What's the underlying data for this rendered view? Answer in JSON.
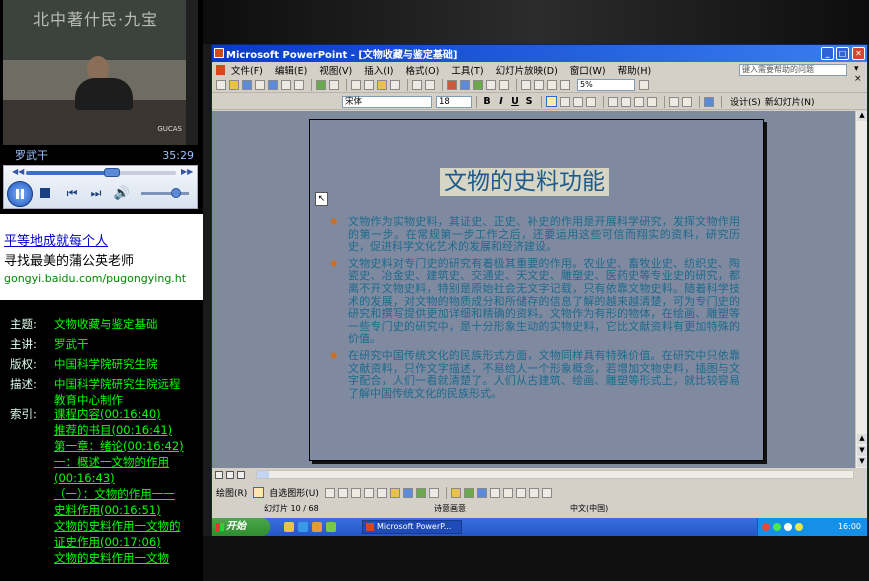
{
  "player": {
    "lecturer_caption": "罗武干",
    "elapsed_time": "35:29",
    "board_text": "北中著什民·九宝",
    "camera_logo": "GUCAS",
    "progress_fraction": 0.57,
    "volume_fraction": 0.72,
    "icons": [
      "rewind-icon",
      "fast-forward-icon",
      "pause-icon",
      "stop-icon",
      "previous-icon",
      "next-icon",
      "volume-icon"
    ]
  },
  "ad": {
    "headline": "平等地成就每个人",
    "subline": "寻找最美的蒲公英老师",
    "url": "gongyi.baidu.com/pugongying.ht"
  },
  "course_info": {
    "rows": [
      {
        "label": "主题:",
        "value": "文物收藏与鉴定基础"
      },
      {
        "label": "主讲:",
        "value": "罗武干"
      },
      {
        "label": "版权:",
        "value": "中国科学院研究生院"
      },
      {
        "label": "描述:",
        "value": "中国科学院研究生院远程教育中心制作"
      }
    ],
    "index_label": "索引:",
    "index_items": [
      "课程内容(00:16:40)",
      "推荐的书目(00:16:41)",
      "第一章：绪论(00:16:42)",
      "一：概述一文物的作用(00:16:43)",
      "（一）：文物的作用一一史料作用(00:16:51)",
      "文物的史料作用一文物的证史作用(00:17:06)",
      "文物的史料作用一文物"
    ]
  },
  "powerpoint": {
    "window_title": "Microsoft PowerPoint - [文物收藏与鉴定基础]",
    "menu": [
      "文件(F)",
      "编辑(E)",
      "视图(V)",
      "插入(I)",
      "格式(O)",
      "工具(T)",
      "幻灯片放映(D)",
      "窗口(W)",
      "帮助(H)"
    ],
    "help_placeholder": "键入需要帮助的问题",
    "zoom": "5%",
    "font_name": "宋体",
    "font_size": "18",
    "format_buttons": [
      "B",
      "I",
      "U",
      "S"
    ],
    "design_button": "设计(S)",
    "new_slide_button": "新幻灯片(N)",
    "slide": {
      "title": "文物的史料功能",
      "bullets": [
        "文物作为实物史料，其证史、正史、补史的作用是开展科学研究，发挥文物作用的第一步。在常规第一步工作之后，还要运用这些可信而翔实的资料，研究历史，促进科学文化艺术的发展和经济建设。",
        "文物史料对专门史的研究有着极其重要的作用。农业史、畜牧业史、纺织史、陶瓷史、冶金史、建筑史、交通史、天文史、雕塑史、医药史等专业史的研究，都离不开文物史料，特别是原始社会无文字记载，只有依靠文物史料。随着科学技术的发展，对文物的物质成分和所储存的信息了解的越来越清楚，可为专门史的研究和撰写提供更加详细和精确的资料。文物作为有形的物体，在绘画、雕塑等一些专门史的研究中，是十分形象生动的实物史料，它比文献资料有更加特殊的价值。",
        "在研究中国传统文化的民族形式方面，文物同样具有特殊价值。在研究中只依靠文献资料，只作文字描述，不易给人一个形象概念，若增加文物史料，插图与文字配合，人们一看就清楚了。人们从古建筑、绘画、雕塑等形式上，就比较容易了解中国传统文化的民族形式。"
      ]
    },
    "drawing_toolbar": {
      "draw_label": "绘图(R)",
      "autoshape_label": "自选图形(U)"
    },
    "status": {
      "slide_pos": "幻灯片 10 / 68",
      "design": "诗意画意",
      "language": "中文(中国)"
    },
    "taskbar": {
      "start_label": "开始",
      "task_label": "Microsoft PowerP...",
      "clock": "16:00"
    }
  }
}
